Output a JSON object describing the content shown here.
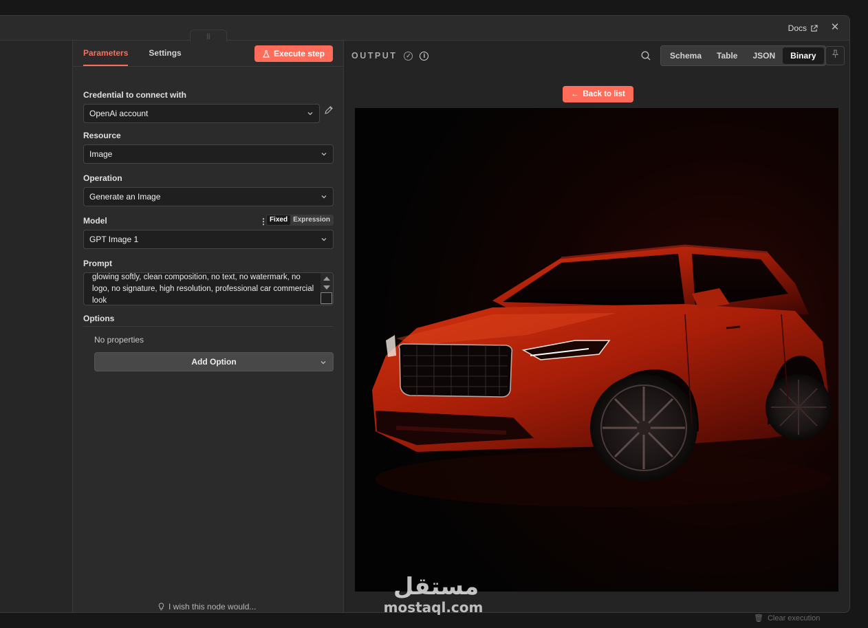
{
  "header": {
    "docs_label": "Docs",
    "close_icon": "close-icon"
  },
  "params": {
    "tabs": [
      {
        "label": "Parameters",
        "active": true
      },
      {
        "label": "Settings",
        "active": false
      }
    ],
    "execute_label": "Execute step",
    "credential": {
      "label": "Credential to connect with",
      "value": "OpenAi account"
    },
    "resource": {
      "label": "Resource",
      "value": "Image"
    },
    "operation": {
      "label": "Operation",
      "value": "Generate an Image"
    },
    "model": {
      "label": "Model",
      "value": "GPT Image 1",
      "toggle_fixed": "Fixed",
      "toggle_expression": "Expression"
    },
    "prompt": {
      "label": "Prompt",
      "value": "glowing softly, clean composition, no text, no watermark, no logo, no signature, high resolution, professional car commercial look"
    },
    "options": {
      "label": "Options",
      "empty_text": "No properties",
      "add_label": "Add Option"
    },
    "feedback_label": "I wish this node would..."
  },
  "output": {
    "title": "OUTPUT",
    "views": [
      {
        "label": "Schema",
        "active": false
      },
      {
        "label": "Table",
        "active": false
      },
      {
        "label": "JSON",
        "active": false
      },
      {
        "label": "Binary",
        "active": true
      }
    ],
    "back_label": "Back to list",
    "image_subject": "red SUV on dark studio background"
  },
  "background": {
    "clear_execution_label": "Clear execution"
  },
  "watermark": {
    "arabic": "مستقل",
    "latin": "mostaql.com"
  },
  "colors": {
    "accent": "#ff6d5a",
    "panel": "#2b2b2b",
    "input": "#1f1f1f"
  }
}
